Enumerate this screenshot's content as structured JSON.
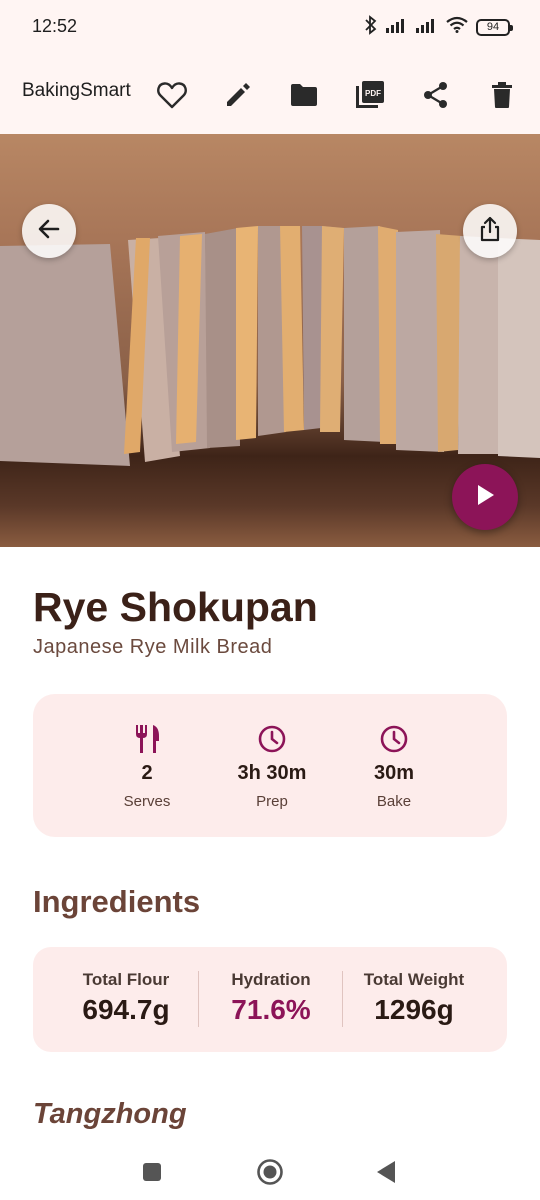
{
  "status_bar": {
    "time": "12:52",
    "battery": "94",
    "icons": [
      "bluetooth-icon",
      "signal-icon",
      "signal-icon",
      "wifi-icon",
      "battery-icon"
    ]
  },
  "app_bar": {
    "title": "BakingSmart",
    "actions": [
      "favorite-icon",
      "edit-icon",
      "folder-icon",
      "pdf-icon",
      "share-icon",
      "delete-icon"
    ]
  },
  "hero": {
    "image": "rye-shokupan-photo",
    "buttons": [
      "back-icon",
      "export-icon",
      "play-icon"
    ]
  },
  "recipe": {
    "title": "Rye Shokupan",
    "subtitle": "Japanese Rye Milk Bread"
  },
  "stats": [
    {
      "icon": "utensils-icon",
      "value": "2",
      "label": "Serves"
    },
    {
      "icon": "clock-icon",
      "value": "3h 30m",
      "label": "Prep"
    },
    {
      "icon": "clock-icon",
      "value": "30m",
      "label": "Bake"
    }
  ],
  "ingredients": {
    "title": "Ingredients",
    "summary": [
      {
        "label": "Total Flour",
        "value": "694.7g"
      },
      {
        "label": "Hydration",
        "value": "71.6%"
      },
      {
        "label": "Total Weight",
        "value": "1296g"
      }
    ],
    "subsection": "Tangzhong"
  },
  "colors": {
    "accent": "#8c1458",
    "heading": "#3b2118",
    "section": "#6b4438",
    "card": "#fdeceb",
    "bar": "#fff5f3"
  },
  "nav": [
    "recents-icon",
    "home-icon",
    "back-nav-icon"
  ]
}
